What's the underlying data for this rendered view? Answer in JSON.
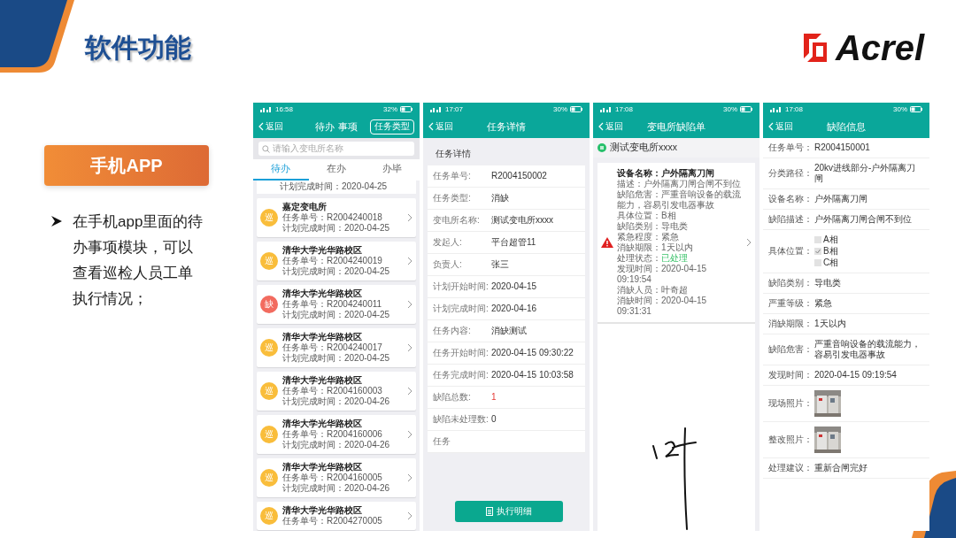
{
  "slide": {
    "title": "软件功能",
    "logo": "Acrel",
    "section_label": "手机APP",
    "bullet": "在手机app里面的待办事项模块，可以查看巡检人员工单执行情况；"
  },
  "todo_screen": {
    "status_bar": {
      "time": "16:58",
      "battery": "32%"
    },
    "back": "返回",
    "title": "待办 事项",
    "filter_button": "任务类型",
    "search": {
      "placeholder": "请输入变电所名称"
    },
    "tabs": [
      {
        "label": "待办",
        "selected": true
      },
      {
        "label": "在办",
        "selected": false
      },
      {
        "label": "办毕",
        "selected": false
      }
    ],
    "partial_item": {
      "due": "计划完成时间：2020-04-25"
    },
    "items": [
      {
        "badge": "巡",
        "color": "#f9bd3b",
        "title": "嘉定变电所",
        "number": "任务单号：R2004240018",
        "due": "计划完成时间：2020-04-25"
      },
      {
        "badge": "巡",
        "color": "#f9bd3b",
        "title": "清华大学光华路校区",
        "number": "任务单号：R2004240019",
        "due": "计划完成时间：2020-04-25"
      },
      {
        "badge": "缺",
        "color": "#f26b5f",
        "title": "清华大学光华路校区",
        "number": "任务单号：R2004240011",
        "due": "计划完成时间：2020-04-25"
      },
      {
        "badge": "巡",
        "color": "#f9bd3b",
        "title": "清华大学光华路校区",
        "number": "任务单号：R2004240017",
        "due": "计划完成时间：2020-04-25"
      },
      {
        "badge": "巡",
        "color": "#f9bd3b",
        "title": "清华大学光华路校区",
        "number": "任务单号：R2004160003",
        "due": "计划完成时间：2020-04-26"
      },
      {
        "badge": "巡",
        "color": "#f9bd3b",
        "title": "清华大学光华路校区",
        "number": "任务单号：R2004160006",
        "due": "计划完成时间：2020-04-26"
      },
      {
        "badge": "巡",
        "color": "#f9bd3b",
        "title": "清华大学光华路校区",
        "number": "任务单号：R2004160005",
        "due": "计划完成时间：2020-04-26"
      },
      {
        "badge": "巡",
        "color": "#f9bd3b",
        "title": "清华大学光华路校区",
        "number": "任务单号：R2004270005"
      }
    ]
  },
  "task_detail_screen": {
    "status_bar": {
      "time": "17:07",
      "battery": "30%"
    },
    "back": "返回",
    "title": "任务详情",
    "section": "任务详情",
    "rows": [
      {
        "label": "任务单号:",
        "value": "R2004150002",
        "alert": false
      },
      {
        "label": "任务类型:",
        "value": "消缺",
        "alert": false
      },
      {
        "label": "变电所名称:",
        "value": "测试变电所xxxx",
        "alert": false
      },
      {
        "label": "发起人:",
        "value": "平台超管11",
        "alert": false
      },
      {
        "label": "负责人:",
        "value": "张三",
        "alert": false
      },
      {
        "label": "计划开始时间:",
        "value": "2020-04-15",
        "alert": false
      },
      {
        "label": "计划完成时间:",
        "value": "2020-04-16",
        "alert": false
      },
      {
        "label": "任务内容:",
        "value": "消缺测试",
        "alert": false
      },
      {
        "label": "任务开始时间:",
        "value": "2020-04-15 09:30:22",
        "alert": false
      },
      {
        "label": "任务完成时间:",
        "value": "2020-04-15 10:03:58",
        "alert": false
      },
      {
        "label": "缺陷总数:",
        "value": "1",
        "alert": true
      },
      {
        "label": "缺陷未处理数:",
        "value": "0",
        "alert": false
      },
      {
        "label": "任务"
      }
    ],
    "action_button": "执行明细"
  },
  "defect_list_screen": {
    "status_bar": {
      "time": "17:08",
      "battery": "30%"
    },
    "back": "返回",
    "title": "变电所缺陷单",
    "station": "测试变电所xxxx",
    "device": {
      "label": "设备名称：",
      "value": "户外隔离刀闸"
    },
    "fields": [
      {
        "label": "描述：",
        "value": "户外隔离刀闸合闸不到位",
        "kind": "plain"
      },
      {
        "label": "缺陷危害：",
        "value": "严重音响设备的载流能力，容易引发电器事故",
        "kind": "plain"
      },
      {
        "label": "具体位置：",
        "value": "B相",
        "kind": "plain"
      },
      {
        "label": "缺陷类别：",
        "value": "导电类",
        "kind": "plain"
      },
      {
        "label": "紧急程度：",
        "value": "紧急",
        "kind": "plain"
      },
      {
        "label": "消缺期限：",
        "value": "1天以内",
        "kind": "plain"
      },
      {
        "label": "处理状态：",
        "value": "已处理",
        "kind": "status"
      },
      {
        "label": "发现时间：",
        "value": "2020-04-15 09:19:54",
        "kind": "plain"
      },
      {
        "label": "消缺人员：",
        "value": "叶奇超",
        "kind": "plain"
      },
      {
        "label": "消缺时间：",
        "value": "2020-04-15 09:31:31",
        "kind": "plain"
      }
    ]
  },
  "defect_info_screen": {
    "status_bar": {
      "time": "17:08",
      "battery": "30%"
    },
    "back": "返回",
    "title": "缺陷信息",
    "rows": [
      {
        "kind": "text",
        "label": "任务单号：",
        "value": "R2004150001"
      },
      {
        "kind": "text",
        "label": "分类路径：",
        "value": "20kv进线部分-户外隔离刀闸"
      },
      {
        "kind": "text",
        "label": "设备名称：",
        "value": "户外隔离刀闸"
      },
      {
        "kind": "text",
        "label": "缺陷描述：",
        "value": "户外隔离刀闸合闸不到位"
      },
      {
        "kind": "checks",
        "label": "具体位置：",
        "options": [
          {
            "label": "A相",
            "checked": false
          },
          {
            "label": "B相",
            "checked": true
          },
          {
            "label": "C相",
            "checked": false
          }
        ]
      },
      {
        "kind": "text",
        "label": "缺陷类别：",
        "value": "导电类"
      },
      {
        "kind": "text",
        "label": "严重等级：",
        "value": "紧急"
      },
      {
        "kind": "text",
        "label": "消缺期限：",
        "value": "1天以内"
      },
      {
        "kind": "text",
        "label": "缺陷危害：",
        "value": "严重音响设备的载流能力，容易引发电器事故"
      },
      {
        "kind": "text",
        "label": "发现时间：",
        "value": "2020-04-15 09:19:54"
      },
      {
        "label": "现场照片："
      },
      {
        "label": "整改照片："
      },
      {
        "kind": "text",
        "label": "处理建议：",
        "value": "重新合闸完好"
      }
    ]
  }
}
